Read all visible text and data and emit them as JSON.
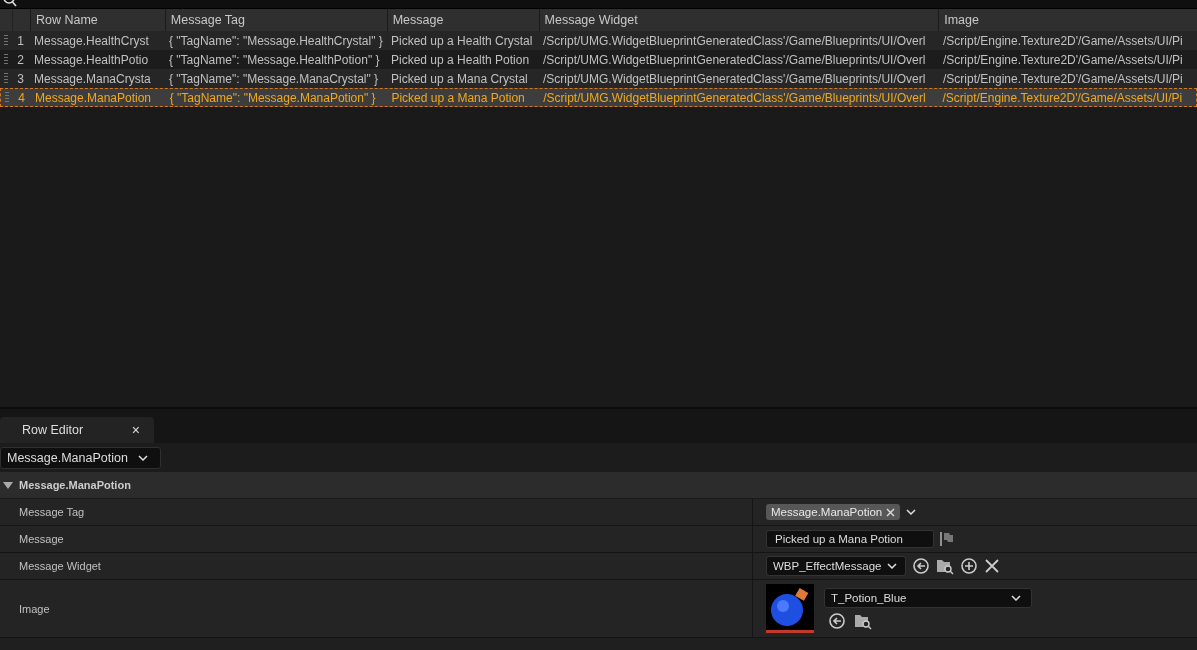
{
  "table": {
    "columns": [
      "Row Name",
      "Message Tag",
      "Message",
      "Message Widget",
      "Image"
    ],
    "rows": [
      {
        "index": "1",
        "cells": [
          "Message.HealthCryst",
          "{ \"TagName\": \"Message.HealthCrystal\" }",
          "Picked up a Health Crystal",
          "/Script/UMG.WidgetBlueprintGeneratedClass'/Game/Blueprints/UI/Overl",
          "/Script/Engine.Texture2D'/Game/Assets/UI/Pi"
        ],
        "selected": false
      },
      {
        "index": "2",
        "cells": [
          "Message.HealthPotio",
          "{ \"TagName\": \"Message.HealthPotion\" }",
          "Picked up a Health Potion",
          "/Script/UMG.WidgetBlueprintGeneratedClass'/Game/Blueprints/UI/Overl",
          "/Script/Engine.Texture2D'/Game/Assets/UI/Pi"
        ],
        "selected": false
      },
      {
        "index": "3",
        "cells": [
          "Message.ManaCrysta",
          "{ \"TagName\": \"Message.ManaCrystal\" }",
          "Picked up a Mana Crystal",
          "/Script/UMG.WidgetBlueprintGeneratedClass'/Game/Blueprints/UI/Overl",
          "/Script/Engine.Texture2D'/Game/Assets/UI/Pi"
        ],
        "selected": false
      },
      {
        "index": "4",
        "cells": [
          "Message.ManaPotion",
          "{ \"TagName\": \"Message.ManaPotion\" }",
          "Picked up a Mana Potion",
          "/Script/UMG.WidgetBlueprintGeneratedClass'/Game/Blueprints/UI/Overl",
          "/Script/Engine.Texture2D'/Game/Assets/UI/Pi"
        ],
        "selected": true
      }
    ]
  },
  "row_editor": {
    "tab": {
      "label": "Row Editor",
      "close": "×"
    },
    "row_selector": "Message.ManaPotion",
    "category": {
      "label": "Message.ManaPotion",
      "expanded": true
    },
    "properties": [
      {
        "kind": "tag",
        "label": "Message Tag",
        "value": "Message.ManaPotion"
      },
      {
        "kind": "text",
        "label": "Message",
        "value": "Picked up a Mana Potion"
      },
      {
        "kind": "class",
        "label": "Message Widget",
        "value": "WBP_EffectMessage"
      },
      {
        "kind": "texture",
        "label": "Image",
        "value": "T_Potion_Blue"
      }
    ]
  }
}
